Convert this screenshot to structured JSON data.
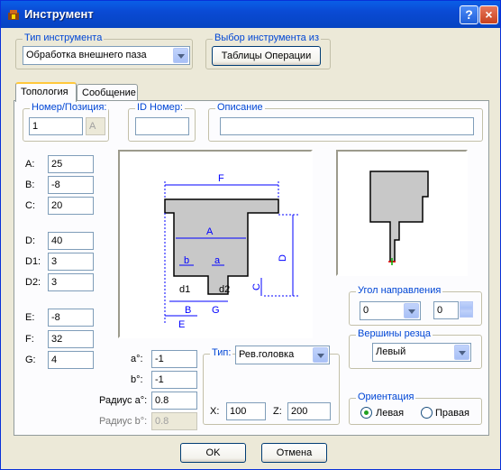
{
  "window": {
    "title": "Инструмент",
    "help": "?",
    "close": "×"
  },
  "tool_type": {
    "legend": "Тип инструмента",
    "value": "Обработка внешнего паза"
  },
  "select_from": {
    "legend": "Выбор инструмента из",
    "button": "Таблицы Операции"
  },
  "tabs": [
    {
      "label": "Топология"
    },
    {
      "label": "Сообщение"
    }
  ],
  "number": {
    "legend": "Номер/Позиция:",
    "value": "1",
    "pos": "A"
  },
  "id": {
    "legend": "ID Номер:",
    "value": ""
  },
  "description": {
    "legend": "Описание",
    "value": ""
  },
  "params": [
    {
      "label": "A:",
      "value": "25"
    },
    {
      "label": "B:",
      "value": "-8"
    },
    {
      "label": "C:",
      "value": "20"
    },
    {
      "label": "D:",
      "value": "40"
    },
    {
      "label": "D1:",
      "value": "3"
    },
    {
      "label": "D2:",
      "value": "3"
    },
    {
      "label": "E:",
      "value": "-8"
    },
    {
      "label": "F:",
      "value": "32"
    },
    {
      "label": "G:",
      "value": "4"
    }
  ],
  "angles": [
    {
      "label": "a°:",
      "value": "-1"
    },
    {
      "label": "b°:",
      "value": "-1"
    },
    {
      "label": "Радиус a°:",
      "value": "0.8"
    },
    {
      "label": "Радиус b°:",
      "value": "0.8"
    }
  ],
  "diagram_labels": {
    "F": "F",
    "A": "A",
    "D": "D",
    "C": "C",
    "b": "b",
    "a": "a",
    "d1": "d1",
    "d2": "d2",
    "B": "B",
    "G": "G",
    "E": "E"
  },
  "type_group": {
    "legend": "Тип:",
    "value": "Рев.головка",
    "x_label": "X:",
    "x": "100",
    "z_label": "Z:",
    "z": "200"
  },
  "direction": {
    "legend": "Угол направления",
    "angle": "0",
    "step": "0"
  },
  "vertex": {
    "legend": "Вершины резца",
    "value": "Левый"
  },
  "orientation": {
    "legend": "Ориентация",
    "left": "Левая",
    "right": "Правая",
    "selected": "left"
  },
  "buttons": {
    "ok": "OK",
    "cancel": "Отмена"
  },
  "colors": {
    "title_bar": "#0a4ad4",
    "legend": "#0046d5",
    "tool_fill": "#c8c8c8"
  }
}
